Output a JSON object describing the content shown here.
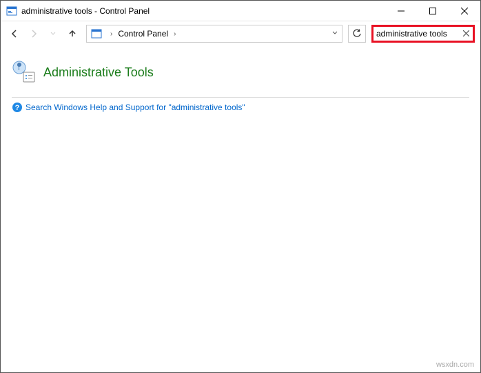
{
  "titlebar": {
    "title": "administrative tools - Control Panel"
  },
  "breadcrumb": {
    "root": "Control Panel"
  },
  "search": {
    "value": "administrative tools"
  },
  "result": {
    "heading": "Administrative Tools"
  },
  "help": {
    "text": "Search Windows Help and Support for \"administrative tools\""
  },
  "watermark": "wsxdn.com"
}
